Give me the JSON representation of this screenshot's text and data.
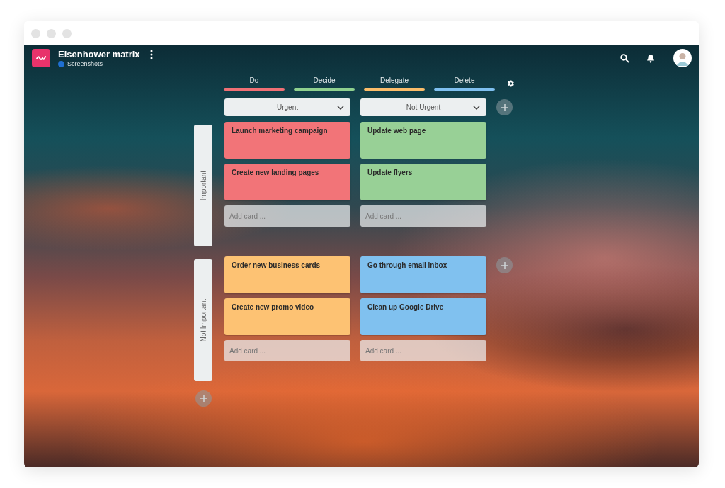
{
  "app": {
    "title": "Eisenhower matrix",
    "workspace": "Screenshots"
  },
  "legend": [
    {
      "label": "Do",
      "color": "#f07075"
    },
    {
      "label": "Decide",
      "color": "#8fd18f"
    },
    {
      "label": "Delegate",
      "color": "#fbbd6a"
    },
    {
      "label": "Delete",
      "color": "#7fc0f0"
    }
  ],
  "columns": [
    {
      "label": "Urgent"
    },
    {
      "label": "Not Urgent"
    }
  ],
  "rows": [
    {
      "label": "Important",
      "add_button": false,
      "cells": [
        {
          "cards": [
            {
              "title": "Launch marketing campaign",
              "color": "#f27478"
            },
            {
              "title": "Create new landing pages",
              "color": "#f27478"
            }
          ],
          "placeholder": "Add card ..."
        },
        {
          "cards": [
            {
              "title": "Update web page",
              "color": "#98d096"
            },
            {
              "title": "Update flyers",
              "color": "#98d096"
            }
          ],
          "placeholder": "Add card ..."
        }
      ]
    },
    {
      "label": "Not Important",
      "add_button": true,
      "cells": [
        {
          "cards": [
            {
              "title": "Order new business cards",
              "color": "#fdc273"
            },
            {
              "title": "Create new promo video",
              "color": "#fdc273"
            }
          ],
          "placeholder": "Add card ..."
        },
        {
          "cards": [
            {
              "title": "Go through email inbox",
              "color": "#80c1ef"
            },
            {
              "title": "Clean up Google Drive",
              "color": "#80c1ef"
            }
          ],
          "placeholder": "Add card ..."
        }
      ]
    }
  ]
}
